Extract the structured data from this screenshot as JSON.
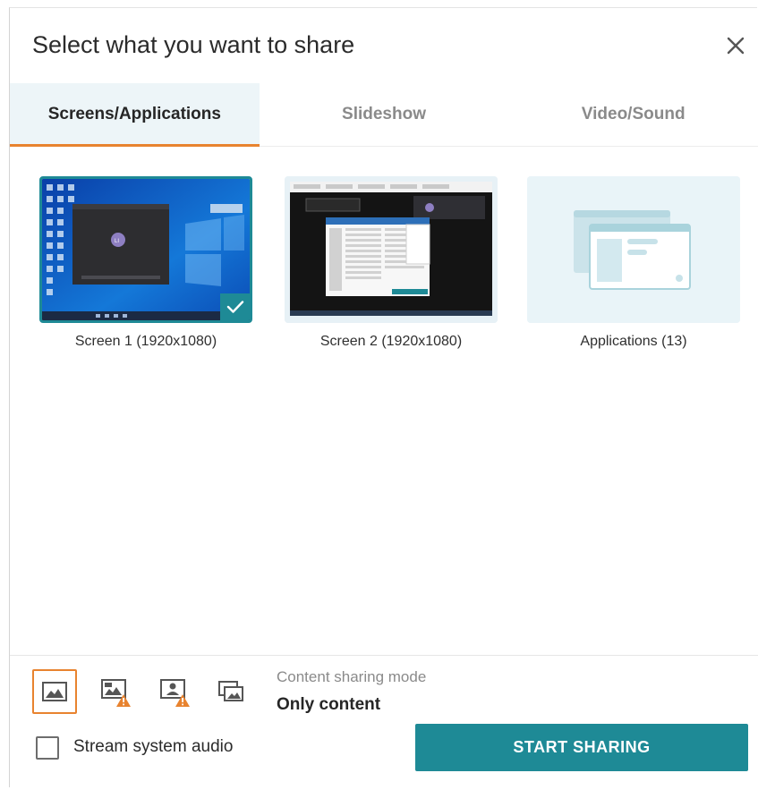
{
  "dialog": {
    "title": "Select what you want to share",
    "close_icon": "close-icon"
  },
  "tabs": [
    {
      "label": "Screens/Applications",
      "active": true
    },
    {
      "label": "Slideshow",
      "active": false
    },
    {
      "label": "Video/Sound",
      "active": false
    }
  ],
  "sources": [
    {
      "label": "Screen 1 (1920x1080)",
      "selected": true
    },
    {
      "label": "Screen 2 (1920x1080)",
      "selected": false
    },
    {
      "label": "Applications (13)",
      "selected": false
    }
  ],
  "footer": {
    "mode_buttons": [
      {
        "icon": "image-mode-icon",
        "active": true,
        "warning": false
      },
      {
        "icon": "image-with-screen-icon",
        "active": false,
        "warning": true
      },
      {
        "icon": "image-with-person-icon",
        "active": false,
        "warning": true
      },
      {
        "icon": "stacked-images-icon",
        "active": false,
        "warning": false
      }
    ],
    "mode_caption": "Content sharing mode",
    "mode_value": "Only content",
    "stream_audio_label": "Stream system audio",
    "stream_audio_checked": false,
    "start_label": "START SHARING"
  },
  "colors": {
    "accent": "#1e8a96",
    "active_tab_underline": "#e8832f",
    "warning": "#e8832f"
  }
}
